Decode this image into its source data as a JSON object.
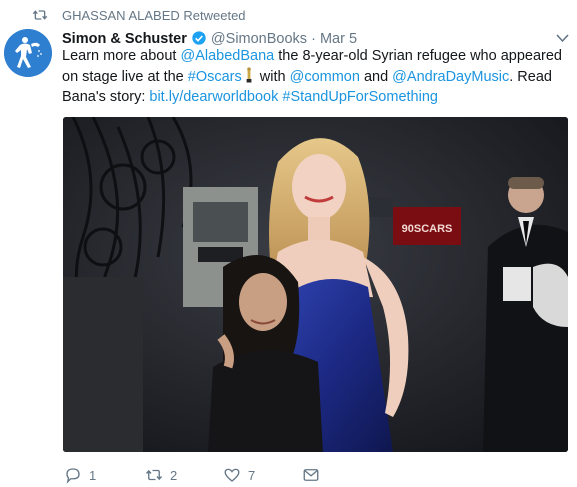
{
  "retweet": {
    "text": "GHASSAN ALABED Retweeted"
  },
  "author": {
    "name": "Simon & Schuster",
    "handle": "@SimonBooks",
    "separator": "·",
    "date": "Mar 5"
  },
  "tweet": {
    "mention1": "@AlabedBana",
    "part1": " the 8-year-old Syrian refugee who appeared on stage live at the ",
    "prefix": "Learn more about ",
    "hashtag1": "#Oscars",
    "part2": " with ",
    "mention2": "@common",
    "part3": " and ",
    "mention3": "@AndraDayMusic",
    "part4": ".  Read Bana's story: ",
    "url": "bit.ly/dearworldbook",
    "space": " ",
    "hashtag2": "#StandUpForSomething"
  },
  "photo": {
    "sign_text": "90SCARS"
  },
  "actions": {
    "reply_count": "1",
    "retweet_count": "2",
    "like_count": "7"
  },
  "colors": {
    "link": "#1b95e0",
    "muted": "#657786",
    "text": "#14171a",
    "verified": "#1da1f2",
    "dress": "#1f2f8f"
  },
  "icons": [
    "retweet-icon",
    "verified-badge-icon",
    "caret-down-icon",
    "trophy-icon",
    "reply-icon",
    "retweet-icon",
    "heart-icon",
    "message-icon"
  ]
}
